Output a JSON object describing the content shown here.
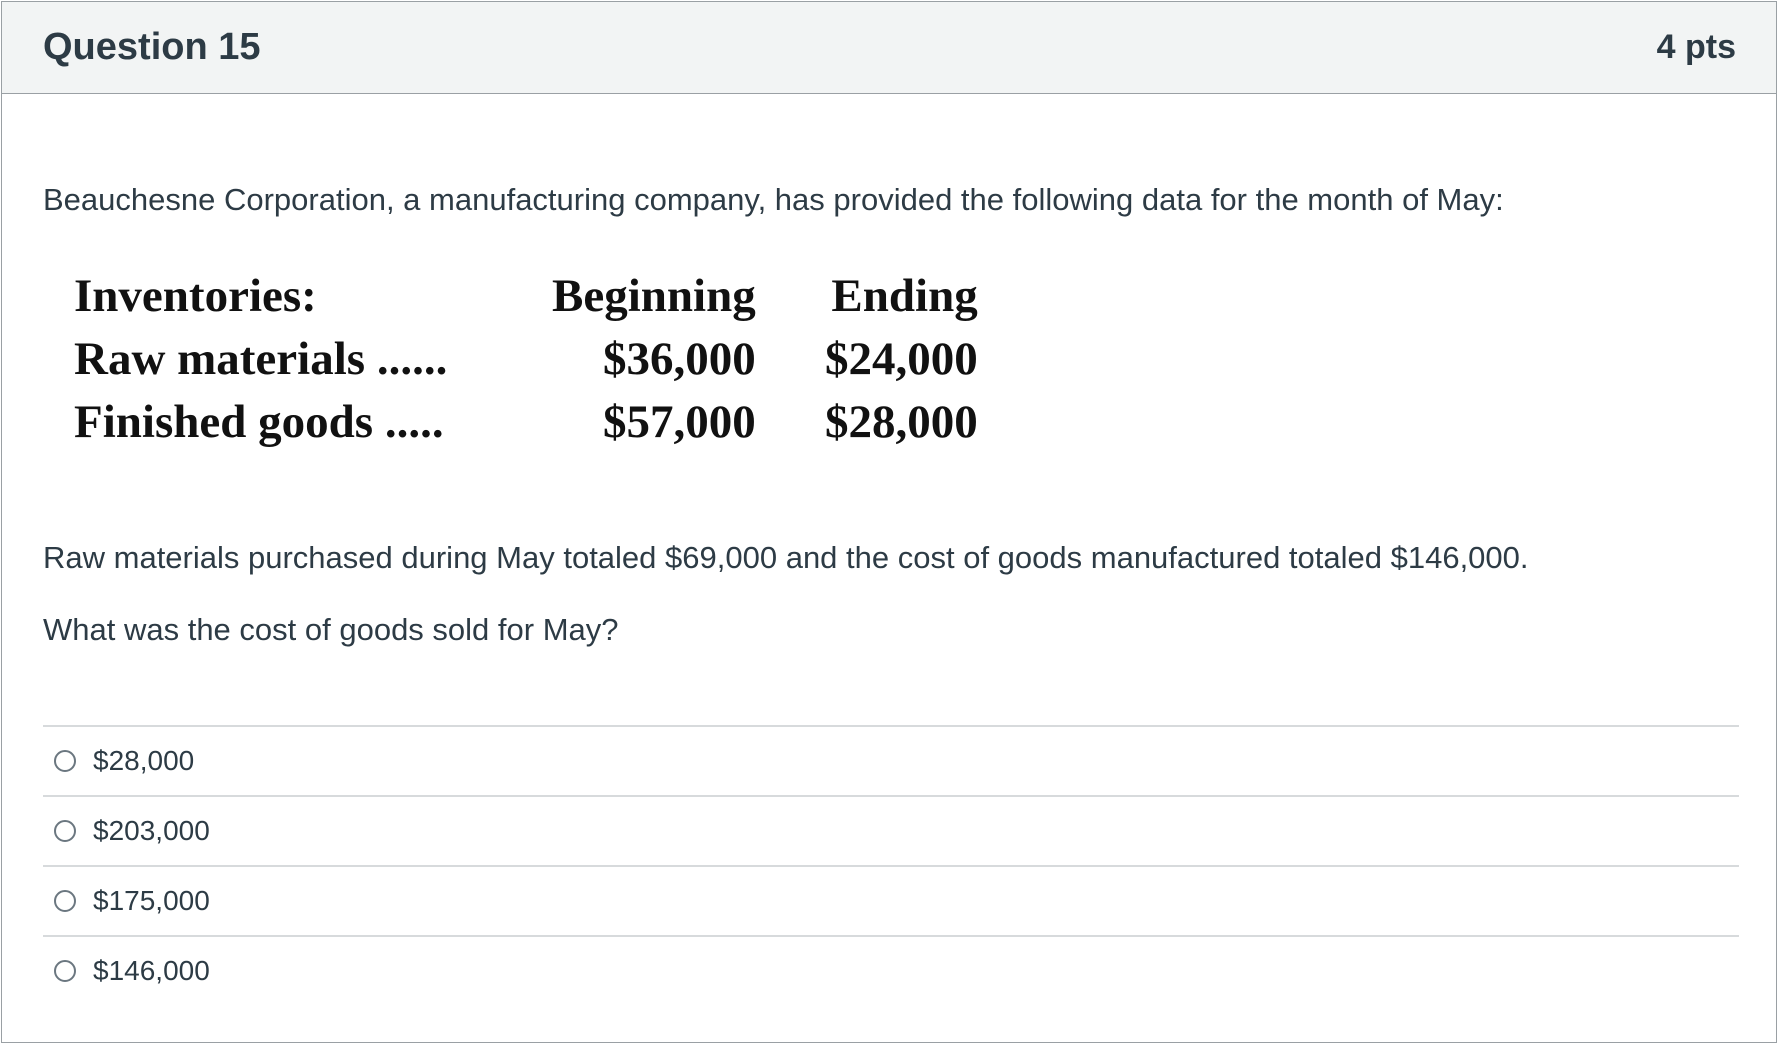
{
  "header": {
    "title": "Question 15",
    "points": "4 pts"
  },
  "question": {
    "intro": "Beauchesne Corporation, a manufacturing company, has provided the following data for the month of May:",
    "table": {
      "header": {
        "label": "Inventories:",
        "beginning": "Beginning",
        "ending": "Ending"
      },
      "rows": [
        {
          "label": "Raw materials ......",
          "beginning": "$36,000",
          "ending": "$24,000"
        },
        {
          "label": "Finished goods .....",
          "beginning": "$57,000",
          "ending": "$28,000"
        }
      ]
    },
    "purchased_text": "Raw materials purchased during May totaled $69,000 and the cost of goods manufactured totaled $146,000.",
    "prompt": "What was the cost of goods sold for May?"
  },
  "answers": [
    {
      "label": "$28,000",
      "selected": false
    },
    {
      "label": "$203,000",
      "selected": false
    },
    {
      "label": "$175,000",
      "selected": false
    },
    {
      "label": "$146,000",
      "selected": false
    }
  ]
}
